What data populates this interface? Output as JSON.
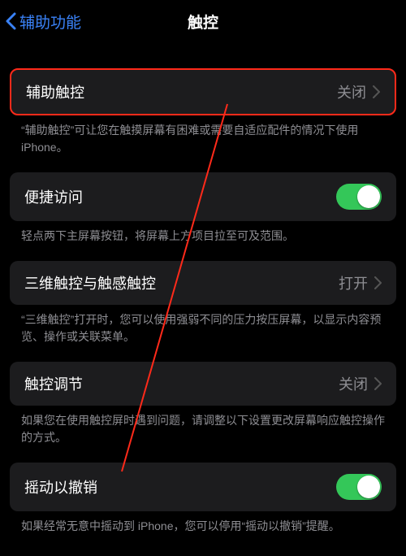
{
  "nav": {
    "back": "辅助功能",
    "title": "触控"
  },
  "rows": {
    "assistiveTouch": {
      "label": "辅助触控",
      "value": "关闭"
    },
    "assistiveTouchFooter": "“辅助触控”可让您在触摸屏幕有困难或需要自适应配件的情况下使用 iPhone。",
    "reachability": {
      "label": "便捷访问"
    },
    "reachabilityFooter": "轻点两下主屏幕按钮，将屏幕上方项目拉至可及范围。",
    "threeD": {
      "label": "三维触控与触感触控",
      "value": "打开"
    },
    "threeDFooter": "“三维触控”打开时，您可以使用强弱不同的压力按压屏幕，以显示内容预览、操作或关联菜单。",
    "touchAccom": {
      "label": "触控调节",
      "value": "关闭"
    },
    "touchAccomFooter": "如果您在使用触控屏时遇到问题，请调整以下设置更改屏幕响应触控操作的方式。",
    "shakeUndo": {
      "label": "摇动以撤销"
    },
    "shakeUndoFooter": "如果经常无意中摇动到 iPhone，您可以停用“摇动以撤销”提醒。"
  }
}
